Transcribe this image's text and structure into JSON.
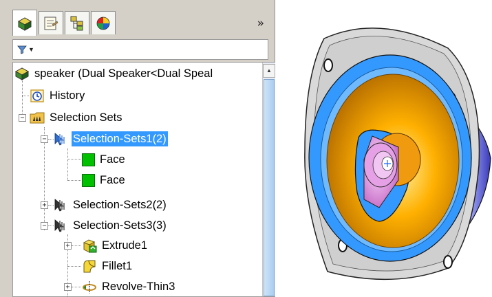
{
  "tabs": [
    {
      "name": "feature-manager",
      "icon": "feature-manager-icon"
    },
    {
      "name": "property-manager",
      "icon": "property-manager-icon"
    },
    {
      "name": "configuration-manager",
      "icon": "configuration-manager-icon"
    },
    {
      "name": "display-manager",
      "icon": "display-manager-icon"
    }
  ],
  "overflow_label": "»",
  "tree": {
    "root": "speaker  (Dual Speaker<Dual Speal",
    "history": "History",
    "selection_sets": "Selection Sets",
    "set1": "Selection-Sets1(2)",
    "set1_face1": "Face",
    "set1_face2": "Face",
    "set2": "Selection-Sets2(2)",
    "set3": "Selection-Sets3(3)",
    "extrude": "Extrude1",
    "fillet": "Fillet1",
    "revolve": "Revolve-Thin3"
  },
  "colors": {
    "selection": "#3399ff",
    "face_icon": "#00c000",
    "speaker_orange": "#ffa500",
    "speaker_blue": "#3399ff",
    "speaker_pink": "#e696e6"
  }
}
